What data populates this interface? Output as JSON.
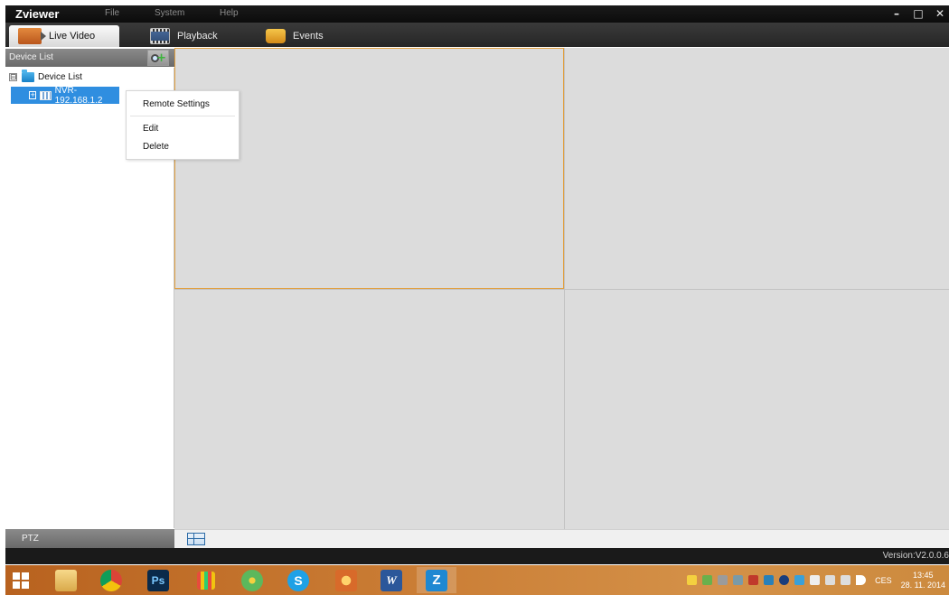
{
  "window": {
    "title": "Zviewer",
    "menu": [
      "File",
      "System",
      "Help"
    ],
    "controls": {
      "minimize": "–",
      "restore": "□",
      "close": "✕"
    }
  },
  "tabs": [
    {
      "label": "Live Video",
      "icon": "camera-icon",
      "active": true
    },
    {
      "label": "Playback",
      "icon": "film-icon",
      "active": false
    },
    {
      "label": "Events",
      "icon": "folder-events-icon",
      "active": false
    }
  ],
  "sidebar": {
    "header": "Device List",
    "add_icon": "add-device-icon",
    "tree": {
      "root": {
        "label": "Device List",
        "expander": "⊟"
      },
      "device": {
        "label": "NVR-192.168.1.2",
        "expander": "+",
        "selected": true
      }
    },
    "ptz_label": "PTZ"
  },
  "context_menu": {
    "items": [
      "Remote Settings",
      "Edit",
      "Delete"
    ]
  },
  "video_grid": {
    "layout": "2x2",
    "active_cell": 0,
    "border_active_color": "#e2a040"
  },
  "status": {
    "version": "Version:V2.0.0.6"
  },
  "taskbar": {
    "apps": [
      "file-explorer-icon",
      "chrome-icon",
      "photoshop-icon",
      "metro-apps-icon",
      "icq-icon",
      "skype-icon",
      "game-icon",
      "word-icon",
      "zviewer-icon"
    ],
    "app_labels": {
      "photoshop": "Ps",
      "skype": "S",
      "word": "W",
      "zviewer": "Z"
    },
    "tray_lang": "CES",
    "clock_time": "13:45",
    "clock_date": "28. 11. 2014"
  },
  "colors": {
    "accent": "#2f8ee0",
    "title_bar": "#111111",
    "grid_bg": "#dcdcdc",
    "taskbar": "#c97b33"
  }
}
